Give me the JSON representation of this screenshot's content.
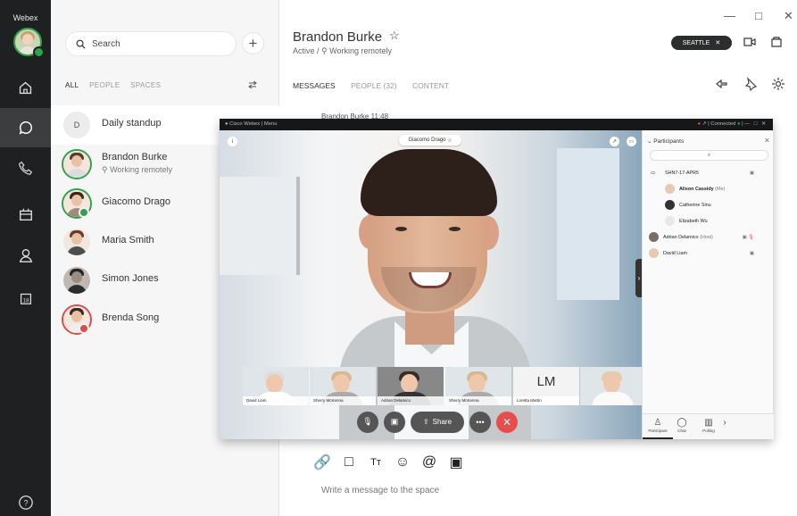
{
  "app": {
    "name": "Webex"
  },
  "rail": {
    "items": [
      "home",
      "messages",
      "calls",
      "meetings",
      "contacts",
      "calendar",
      "help"
    ]
  },
  "sidebar": {
    "search_placeholder": "Search",
    "filters": [
      {
        "label": "ALL",
        "active": true
      },
      {
        "label": "PEOPLE",
        "active": false
      },
      {
        "label": "SPACES",
        "active": false
      }
    ],
    "conversations": [
      {
        "name": "Daily standup",
        "status": "",
        "initial": "D",
        "avatar_color": "#ececec"
      },
      {
        "name": "Brandon Burke",
        "status": "Working remotely",
        "avatar_color": "#f0d2bc"
      },
      {
        "name": "Giacomo Drago",
        "status": "",
        "avatar_color": "#f0cfba"
      },
      {
        "name": "Maria Smith",
        "status": "",
        "avatar_color": "#eec0ad"
      },
      {
        "name": "Simon Jones",
        "status": "",
        "avatar_color": "#8f8a86"
      },
      {
        "name": "Brenda Song",
        "status": "",
        "avatar_color": "#efcec0"
      }
    ]
  },
  "header": {
    "name": "Brandon Burke",
    "status_prefix": "Active",
    "status": "Working remotely",
    "location": "SEATTLE",
    "tabs": [
      {
        "label": "MESSAGES",
        "active": true
      },
      {
        "label": "PEOPLE (32)",
        "active": false
      },
      {
        "label": "CONTENT",
        "active": false
      }
    ]
  },
  "message_preview": {
    "sender": "Brandon Burke",
    "time": "11:48"
  },
  "call": {
    "title": "Cisco Webex",
    "menu": "Menu",
    "connection": "Connected",
    "speaker": "Giacomo Drago",
    "thumbnails": [
      {
        "label": "David Liam"
      },
      {
        "label": "Sherry McKenna"
      },
      {
        "label": "Adrian Delamico"
      },
      {
        "label": "Sherry McKenna"
      },
      {
        "label": "Loretta Martin",
        "initials": "LM"
      },
      {
        "label": ""
      }
    ],
    "share_label": "Share",
    "controls": [
      "mute",
      "video",
      "share",
      "more",
      "end-call"
    ]
  },
  "participants": {
    "title": "Participants",
    "room": "SHN7-17-APR5",
    "people": [
      {
        "name": "Alison Cassidy",
        "suffix": "(Me)"
      },
      {
        "name": "Catherine Sinu",
        "suffix": ""
      },
      {
        "name": "Elizabeth Wu",
        "suffix": ""
      },
      {
        "name": "Adrian Delamico",
        "suffix": "(Host)"
      },
      {
        "name": "David Liam",
        "suffix": ""
      }
    ],
    "tabs": [
      "Participant",
      "Chat",
      "Polling"
    ]
  },
  "composer": {
    "placeholder": "Write a message to the space"
  },
  "colors": {
    "rail": "#1e2021",
    "accent_green": "#2fa24a",
    "end_call": "#e84d4d"
  }
}
